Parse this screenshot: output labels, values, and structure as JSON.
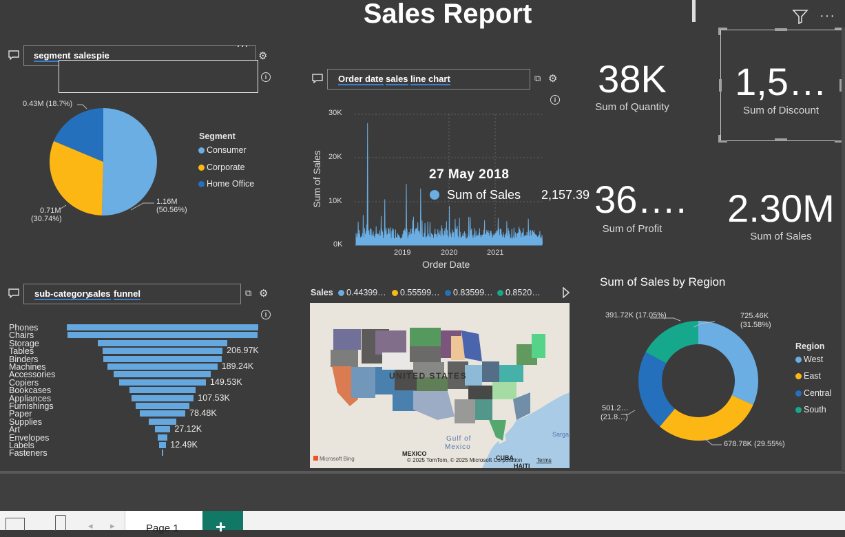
{
  "report": {
    "title": "Sales Report"
  },
  "pie": {
    "header_words": [
      "segment",
      "sales",
      "pie"
    ],
    "legend_title": "Segment",
    "legend": [
      {
        "label": "Consumer",
        "color": "#6aaee3"
      },
      {
        "label": "Corporate",
        "color": "#fdb714"
      },
      {
        "label": "Home Office",
        "color": "#2470bd"
      }
    ],
    "slice_labels": {
      "consumer": [
        "1.16M",
        "(50.56%)"
      ],
      "corporate": [
        "0.71M",
        "(30.74%)"
      ],
      "home_office": "0.43M (18.7%)"
    }
  },
  "line": {
    "header_words": [
      "Order date",
      "sales",
      "line chart"
    ],
    "y_axis_title": "Sum of Sales",
    "x_axis_title": "Order Date",
    "y_ticks": [
      "30K",
      "20K",
      "10K",
      "0K"
    ],
    "x_ticks": [
      "2019",
      "2020",
      "2021"
    ],
    "tooltip": {
      "date": "27 May 2018",
      "series": "Sum of Sales",
      "value": "2,157.39"
    }
  },
  "kpis": {
    "quantity": {
      "value": "38K",
      "label": "Sum of Quantity"
    },
    "discount": {
      "value": "1,5…",
      "label": "Sum of Discount"
    },
    "profit": {
      "value": "36….",
      "label": "Sum of Profit"
    },
    "sales": {
      "value": "2.30M",
      "label": "Sum of Sales"
    }
  },
  "funnel": {
    "header_words": [
      "sub-category",
      "sales",
      "funnel"
    ],
    "labels": [
      "Phones",
      "Chairs",
      "Storage",
      "Tables",
      "Binders",
      "Machines",
      "Accessories",
      "Copiers",
      "Bookcases",
      "Appliances",
      "Furnishings",
      "Paper",
      "Supplies",
      "Art",
      "Envelopes",
      "Labels",
      "Fasteners"
    ],
    "value_labels": [
      "206.97K",
      "189.24K",
      "149.53K",
      "107.53K",
      "78.48K",
      "27.12K",
      "12.49K"
    ]
  },
  "map": {
    "legend_title": "Sales",
    "legend": [
      {
        "label": "0.44399…",
        "color": "#6aaee3"
      },
      {
        "label": "0.55599…",
        "color": "#fdb714"
      },
      {
        "label": "0.83599…",
        "color": "#2470bd"
      },
      {
        "label": "0.8520…",
        "color": "#16a88c"
      }
    ],
    "place_labels": {
      "country": "UNITED STATES",
      "gulf1": "Gulf of",
      "gulf2": "Mexico",
      "mexico": "MEXICO",
      "cuba": "CUBA",
      "haiti": "HAITI",
      "sarg": "Sarga"
    },
    "credits": "© 2025 TomTom, © 2025 Microsoft Corporation",
    "terms": "Terms",
    "bing": "Microsoft Bing"
  },
  "donut": {
    "title": "Sum of Sales by Region",
    "legend_title": "Region",
    "legend": [
      {
        "label": "West",
        "color": "#6aaee3"
      },
      {
        "label": "East",
        "color": "#fdb714"
      },
      {
        "label": "Central",
        "color": "#2470bd"
      },
      {
        "label": "South",
        "color": "#16a88c"
      }
    ],
    "labels": {
      "west": [
        "725.46K",
        "(31.58%)"
      ],
      "east": "678.78K (29.55%)",
      "central": [
        "501.2…",
        "(21.8…)"
      ],
      "south": "391.72K (17.05%)"
    }
  },
  "tabs": {
    "page1": "Page 1",
    "add": "+"
  },
  "chart_data": [
    {
      "type": "pie",
      "categories": [
        "Consumer",
        "Corporate",
        "Home Office"
      ],
      "values": [
        1.16,
        0.71,
        0.43
      ],
      "percent": [
        50.56,
        30.74,
        18.7
      ],
      "unit": "M"
    },
    {
      "type": "line",
      "ylabel": "Sum of Sales",
      "xlabel": "Order Date",
      "ylim": [
        0,
        30000
      ],
      "tooltip": {
        "date": "27 May 2018",
        "value": 2157.39
      },
      "peaks": [
        {
          "x": "2018-03",
          "y": 28000
        },
        {
          "x": "2018-10",
          "y": 14000
        },
        {
          "x": "2019-03",
          "y": 13000
        }
      ]
    },
    {
      "type": "bar",
      "orientation": "funnel",
      "categories": [
        "Phones",
        "Chairs",
        "Storage",
        "Tables",
        "Binders",
        "Machines",
        "Accessories",
        "Copiers",
        "Bookcases",
        "Appliances",
        "Furnishings",
        "Paper",
        "Supplies",
        "Art",
        "Envelopes",
        "Labels",
        "Fasteners"
      ],
      "values": [
        330.01,
        328.45,
        223.84,
        206.97,
        203.41,
        189.24,
        167.38,
        149.53,
        114.88,
        107.53,
        91.71,
        78.48,
        46.67,
        27.12,
        16.48,
        12.49,
        3.02
      ],
      "unit": "K"
    },
    {
      "type": "pie",
      "donut": true,
      "categories": [
        "West",
        "East",
        "Central",
        "South"
      ],
      "values": [
        725.46,
        678.78,
        501.24,
        391.72
      ],
      "percent": [
        31.58,
        29.55,
        21.82,
        17.05
      ],
      "unit": "K"
    }
  ]
}
